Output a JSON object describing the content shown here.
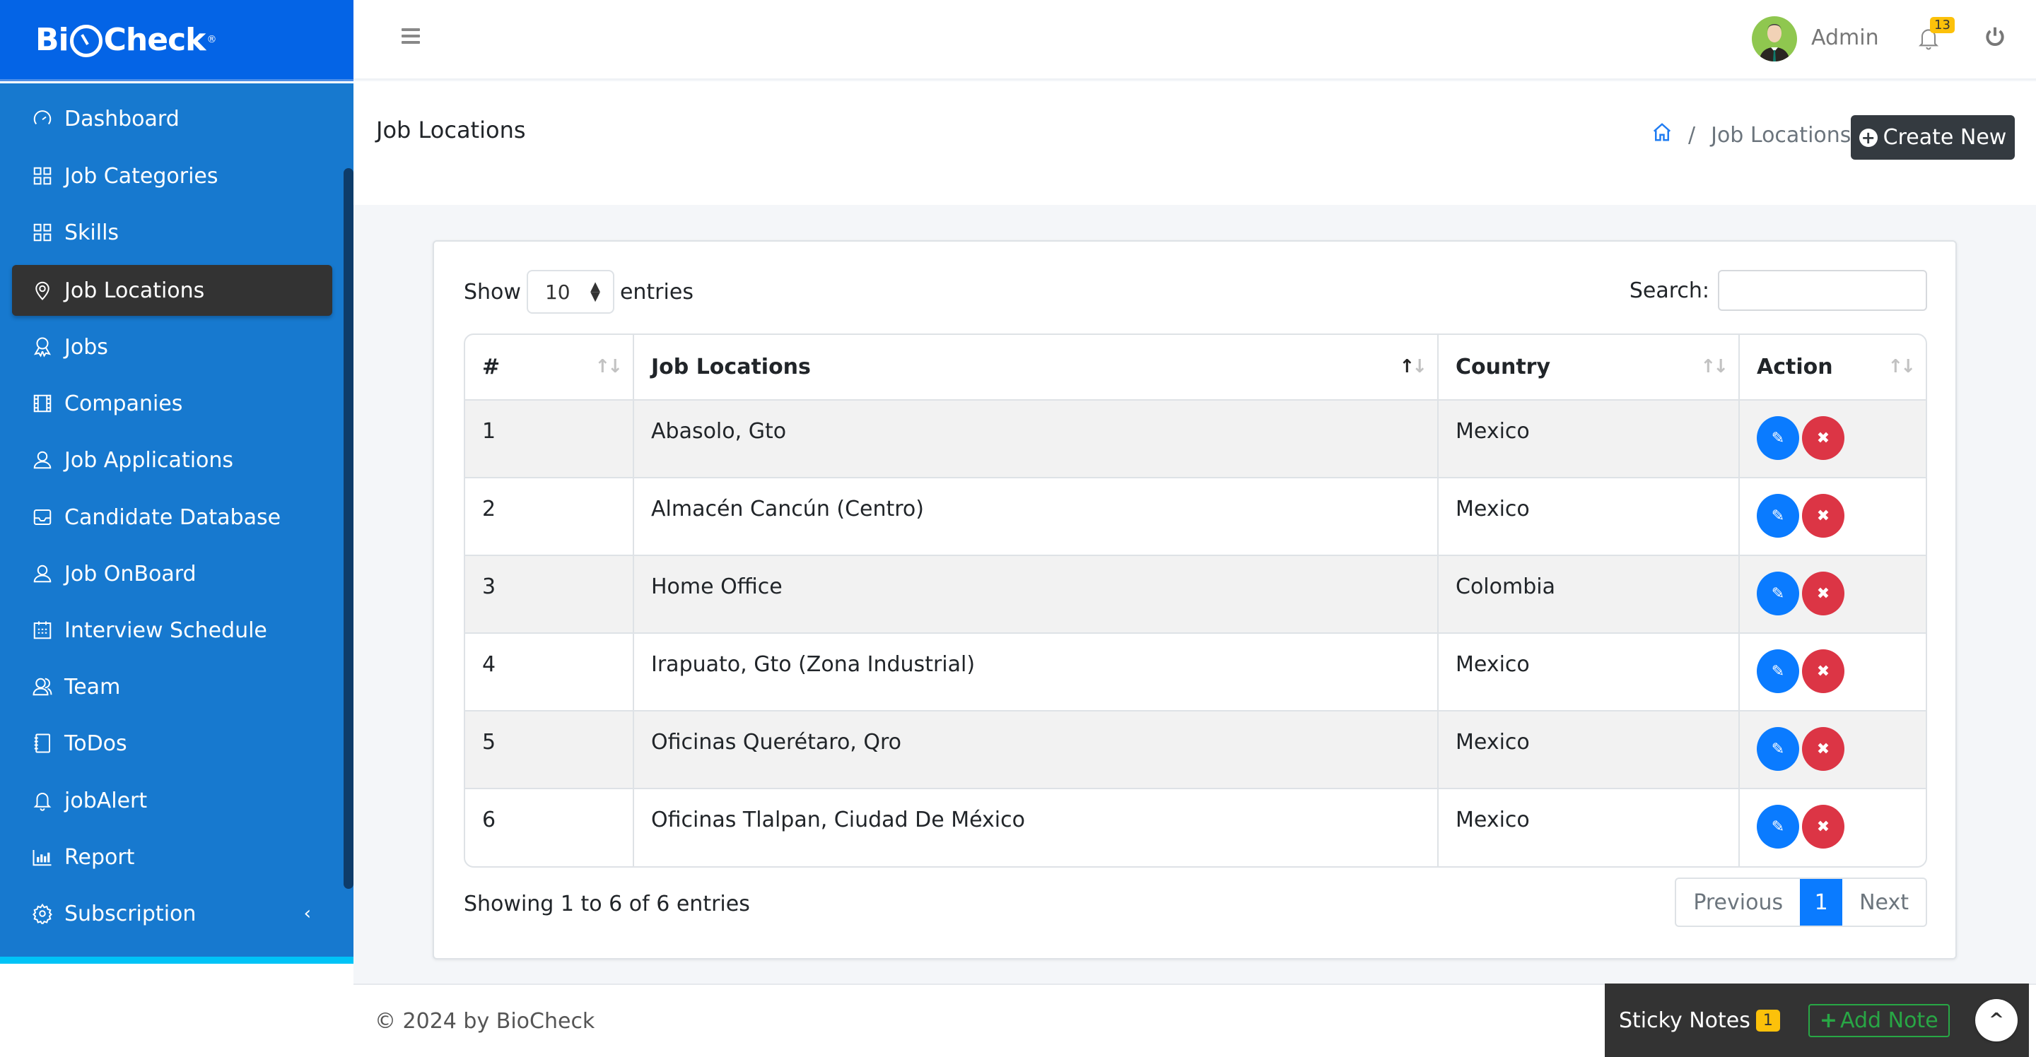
{
  "brand": {
    "name_left": "Bi",
    "name_right": "Check",
    "registered": "®"
  },
  "sidebar": {
    "items": [
      {
        "label": "Dashboard",
        "icon": "dashboard-gauge-icon"
      },
      {
        "label": "Job Categories",
        "icon": "grid-icon"
      },
      {
        "label": "Skills",
        "icon": "grid-icon"
      },
      {
        "label": "Job Locations",
        "icon": "map-pin-icon",
        "active": true
      },
      {
        "label": "Jobs",
        "icon": "award-icon"
      },
      {
        "label": "Companies",
        "icon": "film-icon"
      },
      {
        "label": "Job Applications",
        "icon": "user-icon"
      },
      {
        "label": "Candidate Database",
        "icon": "inbox-icon"
      },
      {
        "label": "Job OnBoard",
        "icon": "user-icon"
      },
      {
        "label": "Interview Schedule",
        "icon": "calendar-icon"
      },
      {
        "label": "Team",
        "icon": "users-icon"
      },
      {
        "label": "ToDos",
        "icon": "notebook-icon"
      },
      {
        "label": "jobAlert",
        "icon": "bell-icon"
      },
      {
        "label": "Report",
        "icon": "bar-chart-icon"
      },
      {
        "label": "Subscription",
        "icon": "gear-icon",
        "expandable": true
      }
    ],
    "chevron": "‹"
  },
  "header": {
    "user_name": "Admin",
    "notification_count": "13"
  },
  "page": {
    "title": "Job Locations",
    "breadcrumb_current": "Job Locations",
    "breadcrumb_separator": "/",
    "create_button": "Create New"
  },
  "table_controls": {
    "show_label": "Show",
    "entries_label": "entries",
    "page_length": "10",
    "search_label": "Search:",
    "search_value": "",
    "search_placeholder": ""
  },
  "table": {
    "columns": [
      "#",
      "Job Locations",
      "Country",
      "Action"
    ],
    "sorted_column": "Job Locations",
    "rows": [
      {
        "num": "1",
        "location": "Abasolo, Gto",
        "country": "Mexico"
      },
      {
        "num": "2",
        "location": "Almacén Cancún (Centro)",
        "country": "Mexico"
      },
      {
        "num": "3",
        "location": "Home Office",
        "country": "Colombia"
      },
      {
        "num": "4",
        "location": "Irapuato, Gto (Zona Industrial)",
        "country": "Mexico"
      },
      {
        "num": "5",
        "location": "Oficinas Querétaro, Qro",
        "country": "Mexico"
      },
      {
        "num": "6",
        "location": "Oficinas Tlalpan, Ciudad De México",
        "country": "Mexico"
      }
    ]
  },
  "pagination": {
    "info": "Showing 1 to 6 of 6 entries",
    "previous": "Previous",
    "current": "1",
    "next": "Next"
  },
  "footer": {
    "copyright": "© 2024 by BioCheck",
    "sticky_notes_label": "Sticky Notes",
    "sticky_notes_count": "1",
    "add_note_label": "Add Note"
  },
  "colors": {
    "sidebar_bg": "#1779cf",
    "brand_bg": "#0464e6",
    "active_item_bg": "#333333",
    "primary": "#0a7bff",
    "danger": "#dc3545",
    "badge": "#fcc10a",
    "success": "#28a745",
    "dark_button": "#343a40"
  }
}
